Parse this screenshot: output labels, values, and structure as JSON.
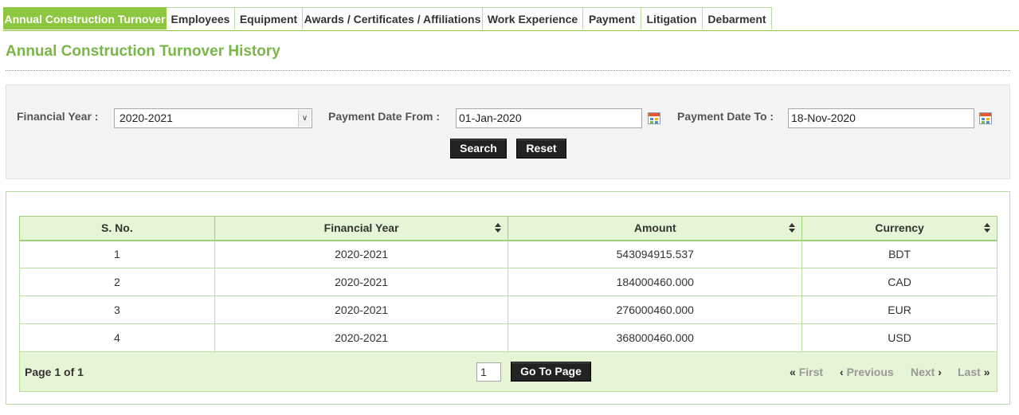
{
  "tabs": [
    {
      "label": "Annual Construction Turnover",
      "active": true
    },
    {
      "label": "Employees"
    },
    {
      "label": "Equipment"
    },
    {
      "label": "Awards / Certificates / Affiliations"
    },
    {
      "label": "Work Experience"
    },
    {
      "label": "Payment"
    },
    {
      "label": "Litigation"
    },
    {
      "label": "Debarment"
    }
  ],
  "page_title": "Annual Construction Turnover History",
  "filter": {
    "financial_year_label": "Financial Year :",
    "financial_year_value": "2020-2021",
    "date_from_label": "Payment Date From :",
    "date_from_value": "01-Jan-2020",
    "date_to_label": "Payment Date To :",
    "date_to_value": "18-Nov-2020",
    "search_label": "Search",
    "reset_label": "Reset"
  },
  "table": {
    "headers": [
      "S. No.",
      "Financial Year",
      "Amount",
      "Currency"
    ],
    "rows": [
      [
        "1",
        "2020-2021",
        "543094915.537",
        "BDT"
      ],
      [
        "2",
        "2020-2021",
        "184000460.000",
        "CAD"
      ],
      [
        "3",
        "2020-2021",
        "276000460.000",
        "EUR"
      ],
      [
        "4",
        "2020-2021",
        "368000460.000",
        "USD"
      ]
    ]
  },
  "pager": {
    "page_info": "Page 1 of 1",
    "page_value": "1",
    "go_label": "Go To Page",
    "first": "First",
    "previous": "Previous",
    "next": "Next",
    "last": "Last"
  },
  "colors": {
    "accent": "#8dc63f",
    "title": "#7ab648",
    "header_bg": "#e6f5d5"
  }
}
